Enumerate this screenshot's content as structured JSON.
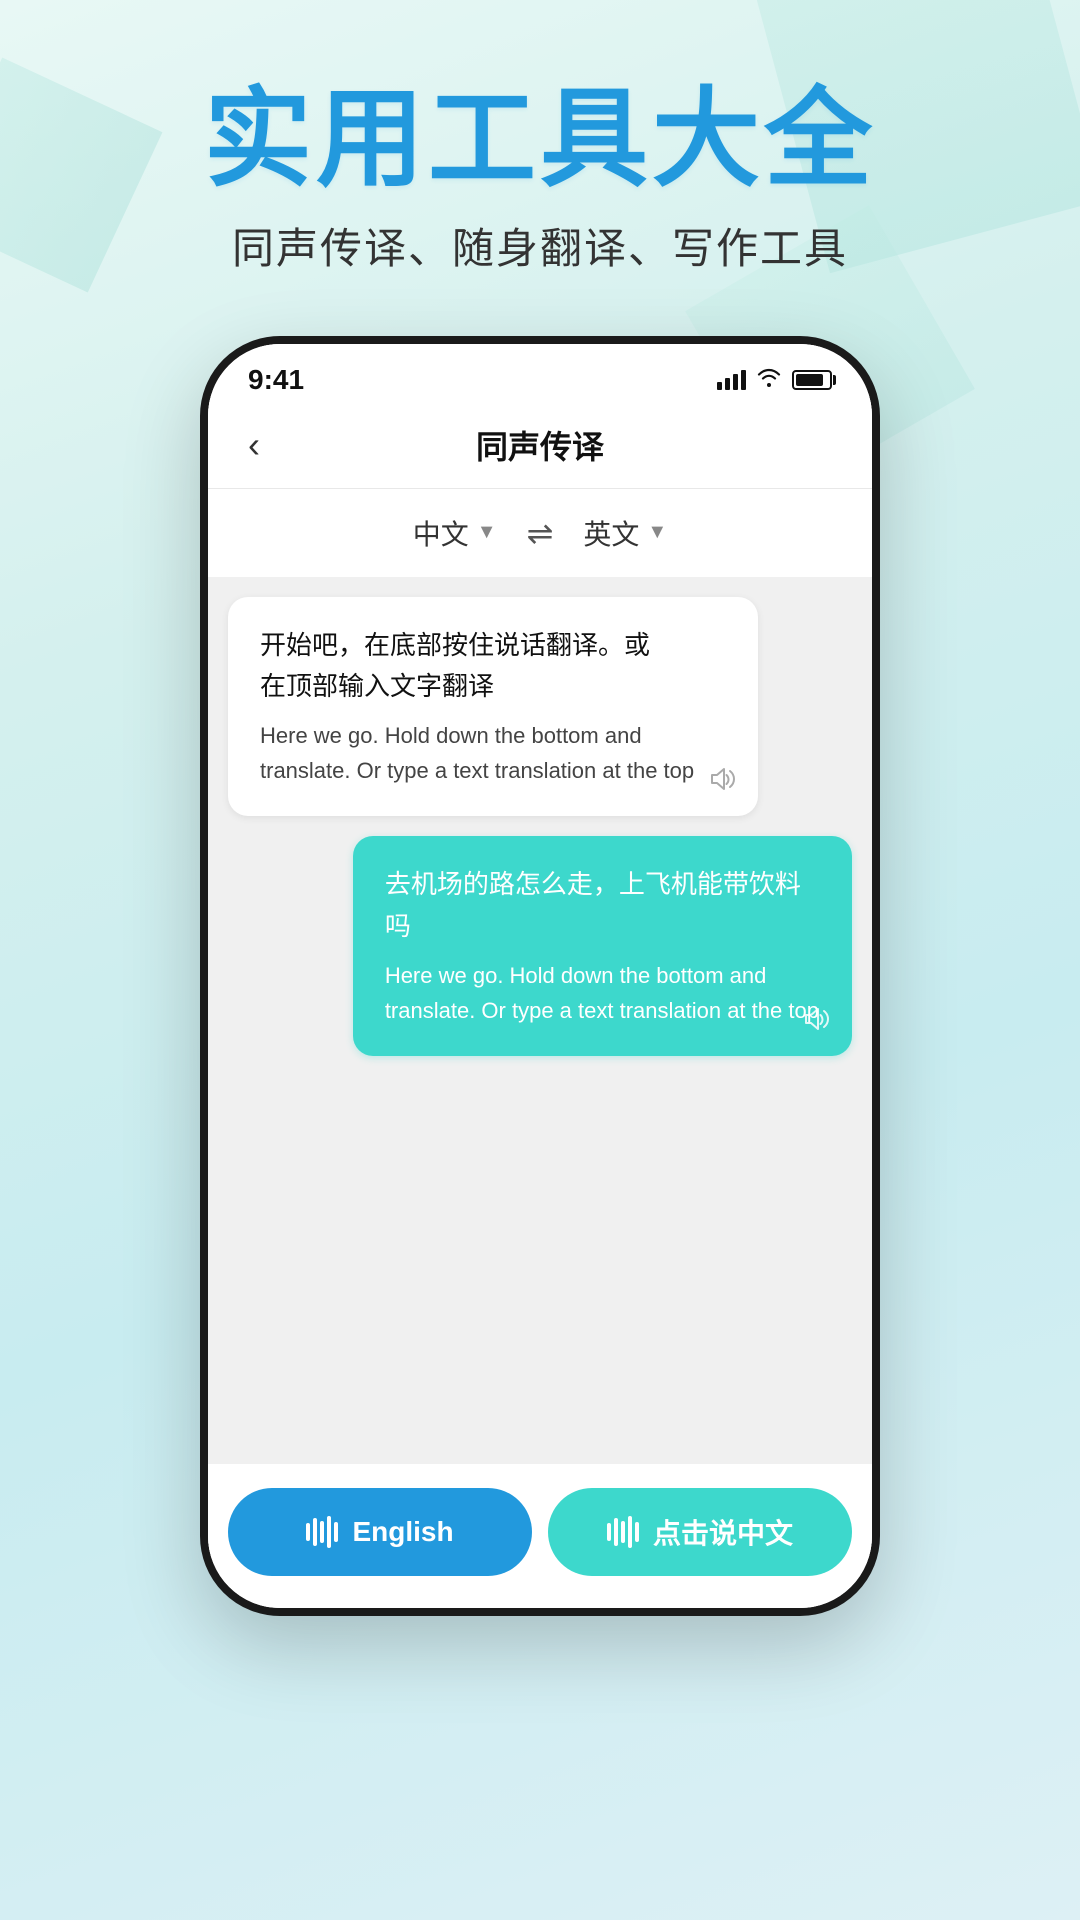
{
  "header": {
    "main_title": "实用工具大全",
    "subtitle": "同声传译、随身翻译、写作工具"
  },
  "phone": {
    "status_bar": {
      "time": "9:41"
    },
    "nav": {
      "back_label": "‹",
      "title": "同声传译"
    },
    "language_selector": {
      "source_lang": "中文",
      "target_lang": "英文",
      "swap_symbol": "⇌"
    },
    "bubbles": [
      {
        "type": "left",
        "chinese": "开始吧，在底部按住说话翻译。或\n在顶部输入文字翻译",
        "english": "Here we go. Hold down the bottom and translate. Or type a text translation at the top",
        "sound": "🔊"
      },
      {
        "type": "right",
        "chinese": "去机场的路怎么走，上飞机能带饮料吗",
        "english": "Here we go. Hold down the bottom and translate. Or type a text translation at the top",
        "sound": "🔊"
      }
    ],
    "buttons": {
      "english_btn": "English",
      "chinese_btn": "点击说中文"
    }
  },
  "colors": {
    "blue": "#2299dd",
    "teal": "#3dd8cc",
    "bg_start": "#e8f8f5",
    "bg_end": "#ddf0f5"
  }
}
